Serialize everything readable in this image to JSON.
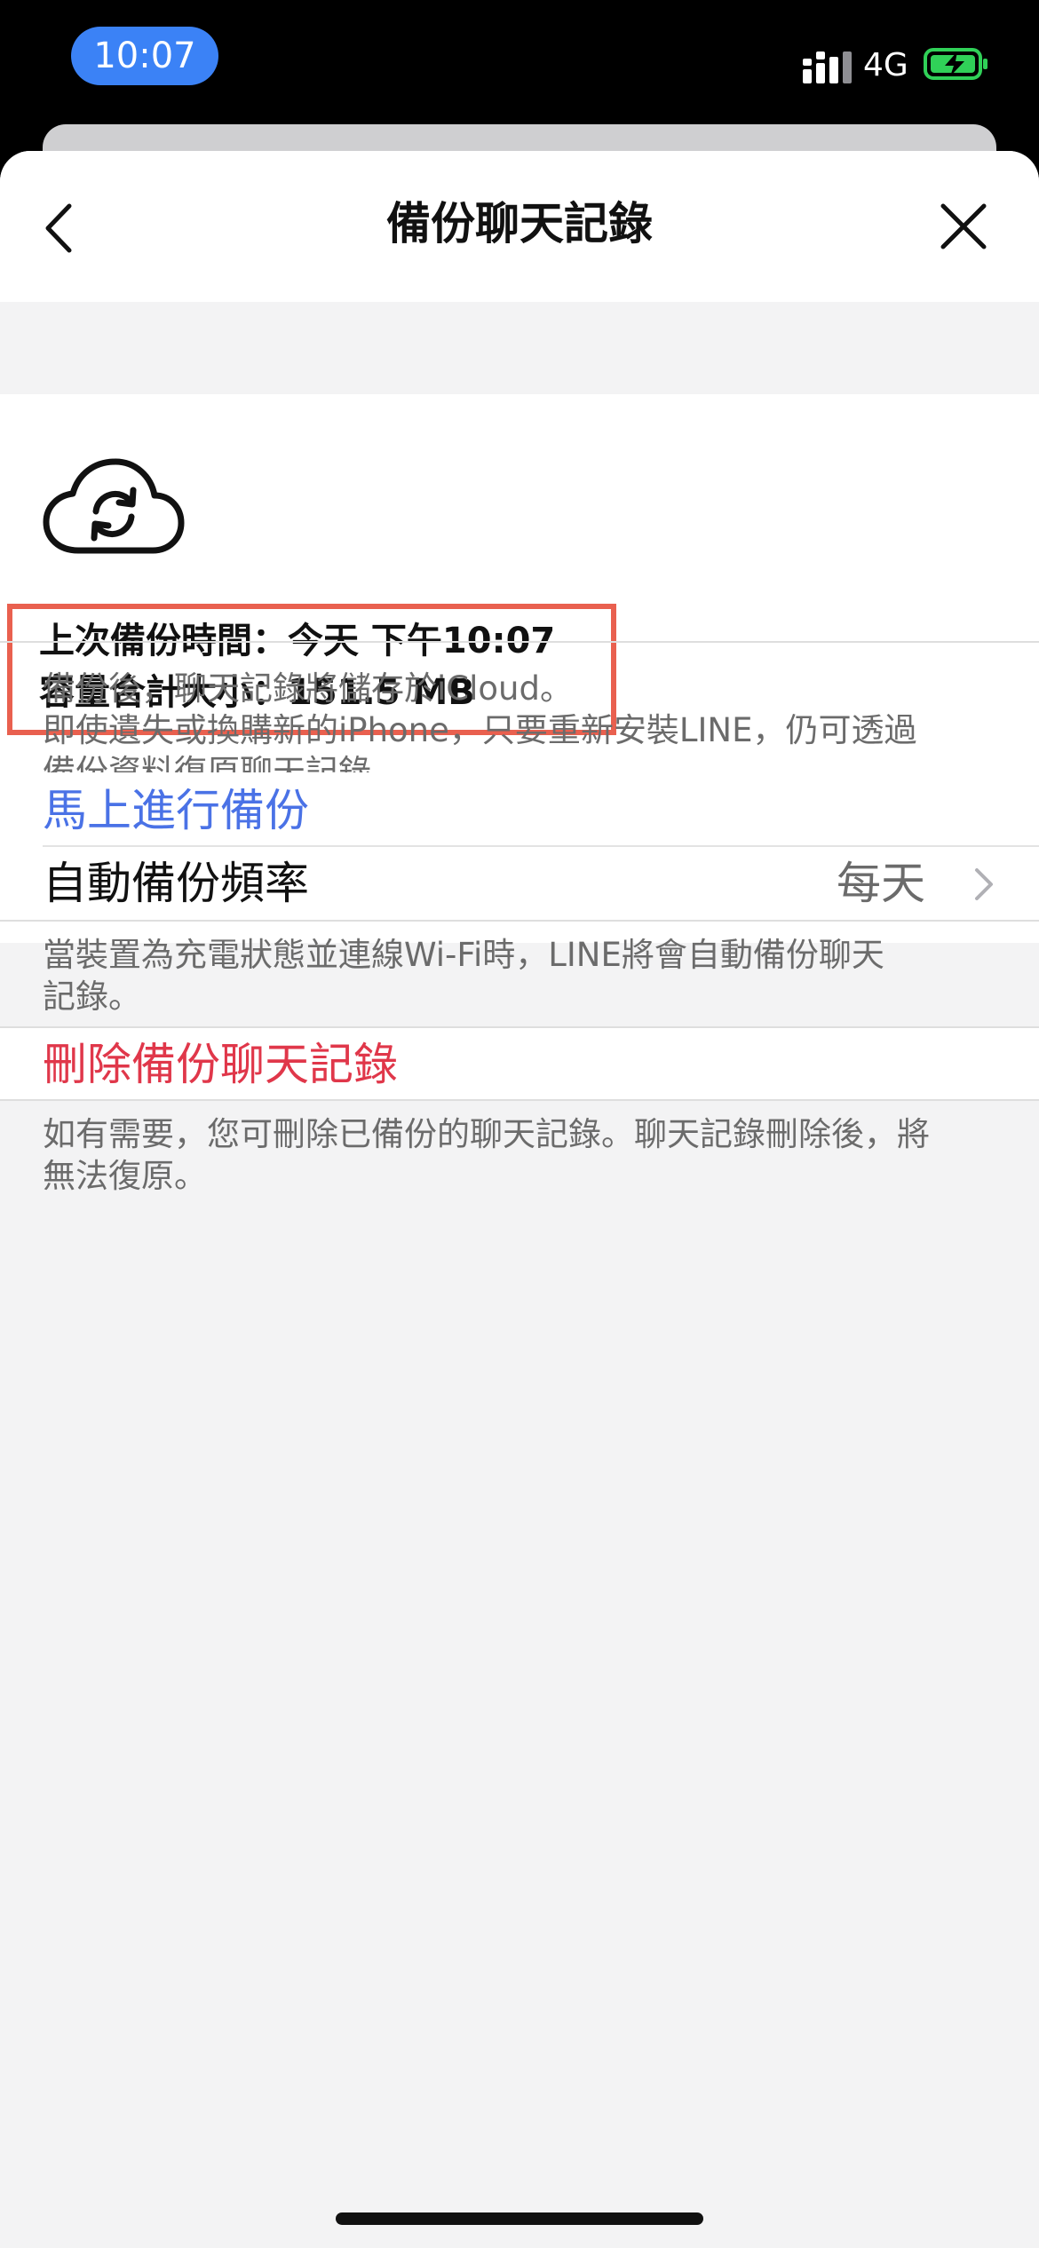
{
  "status_bar": {
    "time": "10:07",
    "network": "4G",
    "time_pill_color": "#3b82f6",
    "battery_color": "#30d158"
  },
  "nav": {
    "title": "備份聊天記錄",
    "back_icon": "chevron-left-icon",
    "close_icon": "close-icon"
  },
  "backup_info": {
    "icon": "cloud-sync-icon",
    "last_backup": "上次備份時間：今天 下午10:07",
    "total_size": "容量合計大小：151.5 MB",
    "highlight_color": "#e9604f"
  },
  "backup_description": {
    "line1": "備份後，聊天記錄將儲存於iCloud。",
    "line2": "即使遺失或換購新的iPhone，只要重新安裝LINE，仍可透過",
    "line3": "備份資料復原聊天記錄。"
  },
  "actions": {
    "backup_now": "馬上進行備份",
    "backup_now_color": "#4a72e6",
    "auto_backup_label": "自動備份頻率",
    "auto_backup_value": "每天",
    "delete_backup": "刪除備份聊天記錄",
    "delete_color": "#e0374a"
  },
  "auto_backup_description": {
    "line1": "當裝置為充電狀態並連線Wi-Fi時，LINE將會自動備份聊天",
    "line2": "記錄。"
  },
  "delete_description": {
    "line1": "如有需要，您可刪除已備份的聊天記錄。聊天記錄刪除後，將",
    "line2": "無法復原。"
  }
}
